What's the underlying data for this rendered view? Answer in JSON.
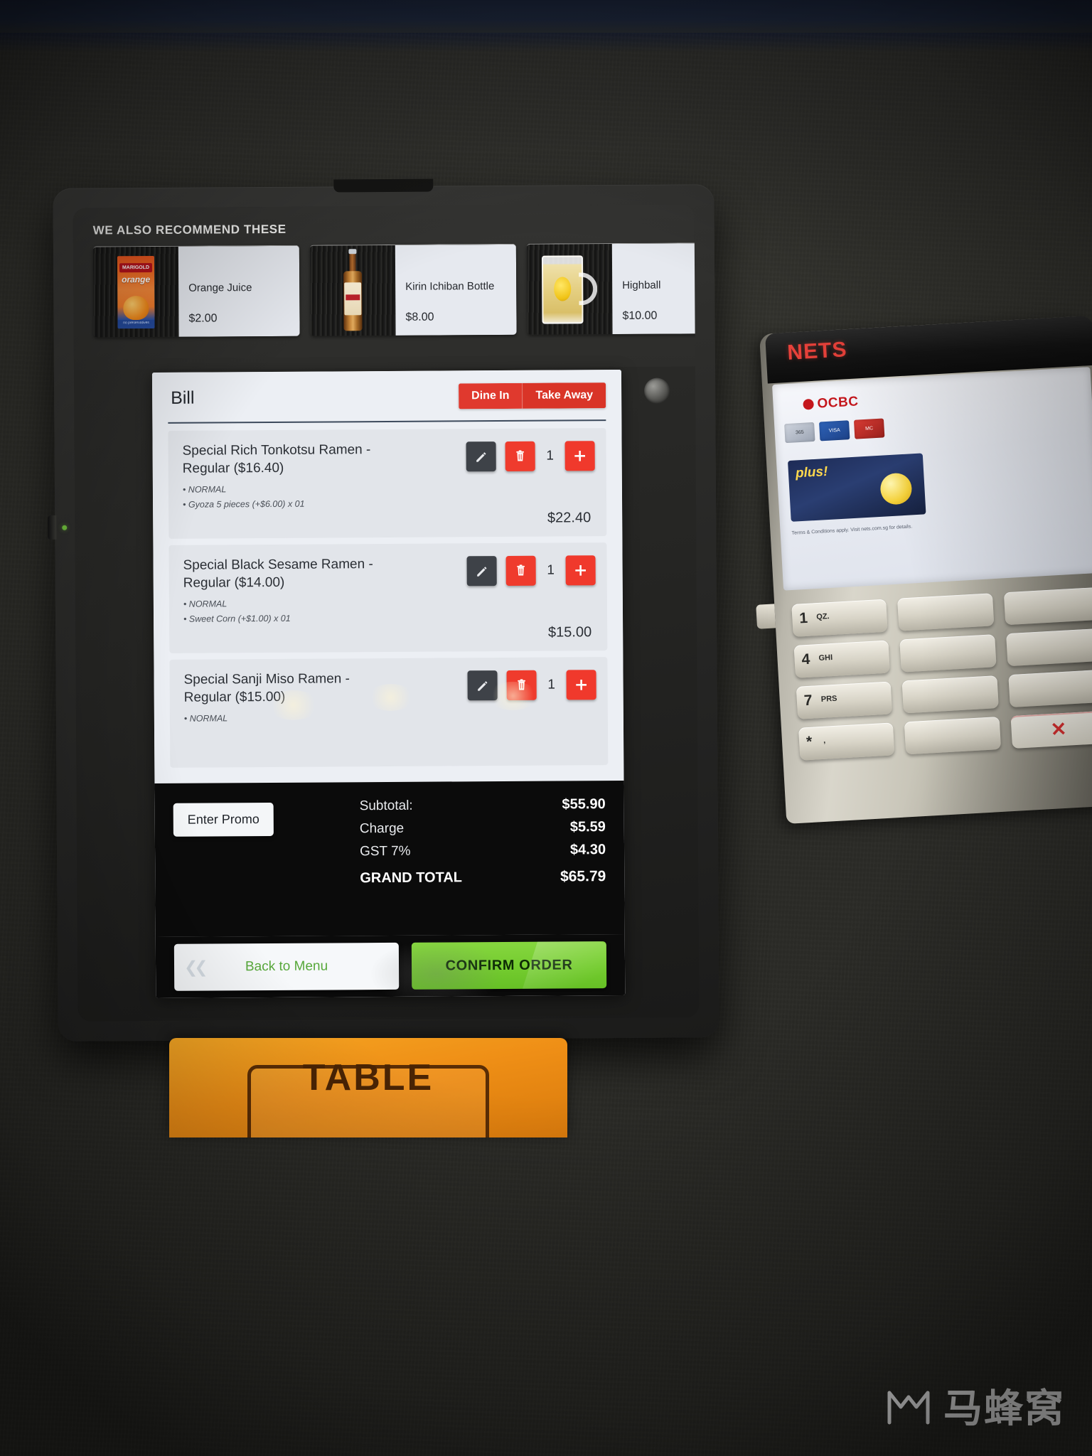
{
  "upsell": {
    "title": "WE ALSO RECOMMEND THESE",
    "cards": [
      {
        "name": "Orange Juice",
        "price": "$2.00",
        "icon": "juice-carton-icon"
      },
      {
        "name": "Kirin Ichiban Bottle",
        "price": "$8.00",
        "icon": "beer-bottle-icon"
      },
      {
        "name": "Highball",
        "price": "$10.00",
        "icon": "beer-mug-icon"
      }
    ]
  },
  "bill": {
    "title": "Bill",
    "order_type": {
      "dine_in": "Dine In",
      "take_away": "Take Away",
      "selected": "Dine In"
    },
    "items": [
      {
        "name": "Special Rich Tonkotsu Ramen - Regular ($16.40)",
        "modifiers": [
          "• NORMAL",
          "• Gyoza 5 pieces (+$6.00) x 01"
        ],
        "qty": "1",
        "line_total": "$22.40"
      },
      {
        "name": "Special Black Sesame Ramen - Regular ($14.00)",
        "modifiers": [
          "• NORMAL",
          "• Sweet Corn (+$1.00) x 01"
        ],
        "qty": "1",
        "line_total": "$15.00"
      },
      {
        "name": "Special Sanji Miso Ramen - Regular ($15.00)",
        "modifiers": [
          "• NORMAL"
        ],
        "qty": "1",
        "line_total": ""
      }
    ],
    "promo_label": "Enter Promo",
    "totals": [
      {
        "label": "Subtotal:",
        "value": "$55.90"
      },
      {
        "label": "Charge",
        "value": "$5.59"
      },
      {
        "label": "GST 7%",
        "value": "$4.30"
      }
    ],
    "grand_total": {
      "label": "GRAND TOTAL",
      "value": "$65.79"
    },
    "back_label": "Back to Menu",
    "confirm_label": "CONFIRM ORDER"
  },
  "terminal": {
    "brand": "NETS",
    "bank": "OCBC",
    "promo_badge": "plus!",
    "fine_print": "Terms & Conditions apply. Visit nets.com.sg for details.",
    "keys": [
      {
        "num": "1",
        "sub": "QZ."
      },
      {
        "num": "4",
        "sub": "GHI"
      },
      {
        "num": "7",
        "sub": "PRS"
      },
      {
        "num": "*",
        "sub": ","
      }
    ]
  },
  "sign": {
    "text": "TABLE"
  },
  "watermark": {
    "text": "马蜂窝"
  },
  "colors": {
    "accent_red": "#e0392e",
    "confirm_green": "#74cc2f",
    "back_green": "#57a83a",
    "dark_panel": "#0b0b0b",
    "screen_bg": "#eceff4"
  }
}
